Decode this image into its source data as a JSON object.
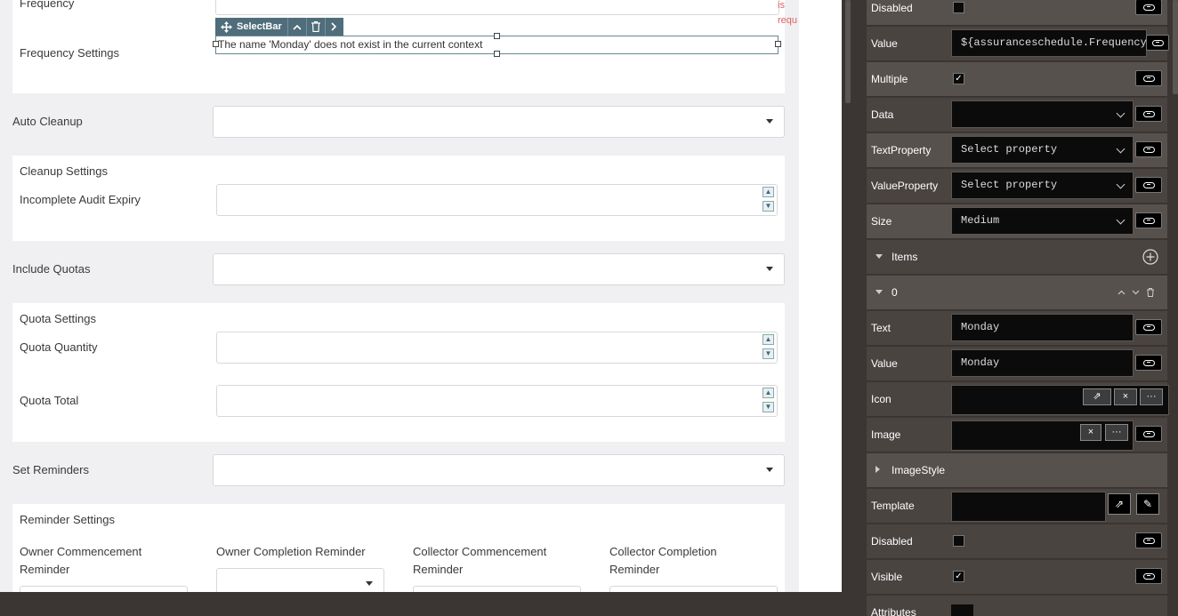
{
  "form": {
    "frequency_label": "Frequency",
    "required_text_1": "is",
    "required_text_2": "requ",
    "frequency_settings_label": "Frequency Settings",
    "selectbar_label": "SelectBar",
    "error_text": "The name 'Monday' does not exist in the current context",
    "auto_cleanup_label": "Auto Cleanup",
    "cleanup_settings_label": "Cleanup Settings",
    "incomplete_audit_expiry_label": "Incomplete Audit Expiry",
    "include_quotas_label": "Include Quotas",
    "quota_settings_label": "Quota Settings",
    "quota_quantity_label": "Quota Quantity",
    "quota_total_label": "Quota Total",
    "set_reminders_label": "Set Reminders",
    "reminder_settings_label": "Reminder Settings",
    "owner_commencement_l1": "Owner Commencement",
    "owner_commencement_l2": "Reminder",
    "owner_completion": "Owner Completion Reminder",
    "collector_commencement_l1": "Collector Commencement",
    "collector_commencement_l2": "Reminder",
    "collector_completion_l1": "Collector Completion",
    "collector_completion_l2": "Reminder"
  },
  "panel": {
    "disabled_label": "Disabled",
    "value_label": "Value",
    "value_text": "${assuranceschedule.Frequency",
    "multiple_label": "Multiple",
    "data_label": "Data",
    "textproperty_label": "TextProperty",
    "textproperty_value": "Select property",
    "valueproperty_label": "ValueProperty",
    "valueproperty_value": "Select property",
    "size_label": "Size",
    "size_value": "Medium",
    "items_label": "Items",
    "item0_label": "0",
    "item_text_label": "Text",
    "item_text_value": "Monday",
    "item_value_label": "Value",
    "item_value_value": "Monday",
    "icon_label": "Icon",
    "image_label": "Image",
    "imagestyle_label": "ImageStyle",
    "template_label": "Template",
    "disabled2_label": "Disabled",
    "visible_label": "Visible",
    "attributes_label": "Attributes",
    "check_mark": "✓"
  },
  "colors": {
    "canvas_bg": "#f0f0f3",
    "selectbar_bg": "#4f6d7a",
    "panel_row": "#57514d",
    "panel_row_alt": "#4a4441",
    "required_red": "#e06060"
  }
}
